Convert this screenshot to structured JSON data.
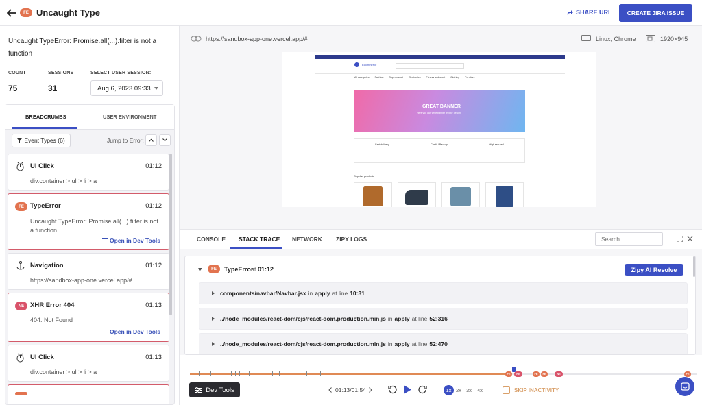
{
  "header": {
    "title": "Uncaught Type",
    "badge": "FE",
    "share_label": "SHARE URL",
    "jira_label": "CREATE JIRA ISSUE",
    "accent": "#3b4fc4"
  },
  "issue": {
    "message": "Uncaught TypeError: Promise.all(...).filter is not a function",
    "count_label": "COUNT",
    "count": "75",
    "sessions_label": "SESSIONS",
    "sessions": "31",
    "select_label": "SELECT USER SESSION:",
    "session_value": "Aug 6, 2023 09:33..."
  },
  "breadcrumbs": {
    "tabs": [
      "BREADCRUMBS",
      "USER ENVIRONMENT"
    ],
    "filter_label": "Event Types (6)",
    "jump_label": "Jump to Error:",
    "open_label": "Open in Dev Tools",
    "items": [
      {
        "title": "UI Click",
        "time": "01:12",
        "desc": "div.container > ul > li > a"
      },
      {
        "title": "TypeError",
        "time": "01:12",
        "badge": "FE",
        "desc": "Uncaught TypeError: Promise.all(...).filter is not a function"
      },
      {
        "title": "Navigation",
        "time": "01:12",
        "desc": "https://sandbox-app-one.vercel.app/#"
      },
      {
        "title": "XHR Error 404",
        "time": "01:13",
        "badge": "NE",
        "desc": "404: Not Found"
      },
      {
        "title": "UI Click",
        "time": "01:13",
        "desc": "div.container > ul > li > a"
      }
    ]
  },
  "session_bar": {
    "url": "https://sandbox-app-one.vercel.app/#",
    "os": "Linux, Chrome",
    "resolution": "1920×945"
  },
  "devtools": {
    "tabs": [
      "CONSOLE",
      "STACK TRACE",
      "NETWORK",
      "ZIPY LOGS"
    ],
    "active_tab": "STACK TRACE",
    "search_placeholder": "Search",
    "error_title": "TypeError",
    "error_at": "at",
    "error_time": "01:12",
    "resolve_label": "Zipy AI Resolve",
    "frames": [
      {
        "file": "components/navbar/Navbar.jsx",
        "fn": "apply",
        "line": "10:31"
      },
      {
        "file": "../node_modules/react-dom/cjs/react-dom.production.min.js",
        "fn": "apply",
        "line": "52:316"
      },
      {
        "file": "../node_modules/react-dom/cjs/react-dom.production.min.js",
        "fn": "apply",
        "line": "52:470"
      }
    ],
    "in_label": "in",
    "at_line_label": "at line"
  },
  "player": {
    "devtools_label": "Dev Tools",
    "time": "01:13/01:54",
    "speeds": [
      "1x",
      "2x",
      "3x",
      "4x"
    ],
    "active_speed": "1x",
    "skip_label": "SKIP INACTIVITY",
    "progress": 0.625
  },
  "preview": {
    "nav_links": [
      "All categories",
      "Fashion",
      "Supermarket",
      "Electronics",
      "Fitness and sport",
      "Clothing",
      "Furniture"
    ],
    "banner_title": "GREAT BANNER",
    "banner_sub": "Here you can write banner text for design",
    "popular": "Popular products",
    "features": [
      "Fast delivery",
      "Credit / Backup",
      "High secured"
    ],
    "brand": "Ecommerce"
  }
}
